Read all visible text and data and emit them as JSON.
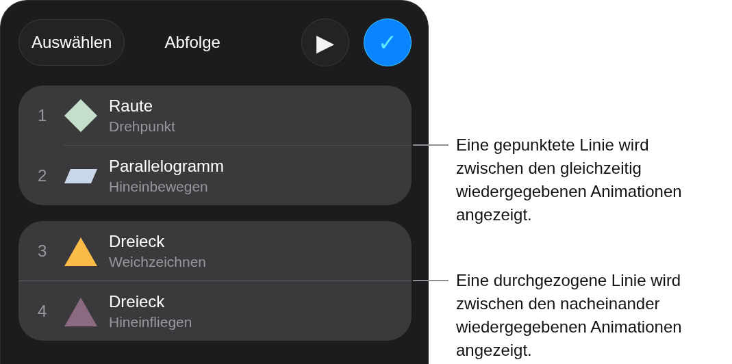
{
  "toolbar": {
    "select_button": "Auswählen",
    "title": "Abfolge",
    "play_button": "▶",
    "done_button": "✓"
  },
  "groups": [
    {
      "dotted": true,
      "items": [
        {
          "number": "1",
          "kind": "diamond",
          "color": "#c5dfcc",
          "title": "Raute",
          "effect": "Drehpunkt"
        },
        {
          "number": "2",
          "kind": "parallelogram",
          "color": "#c9d8e8",
          "title": "Parallelogramm",
          "effect": "Hineinbewegen"
        }
      ]
    },
    {
      "dotted": false,
      "items": [
        {
          "number": "3",
          "kind": "triangle",
          "color": "#fbbc47",
          "title": "Dreieck",
          "effect": "Weichzeichnen"
        },
        {
          "number": "4",
          "kind": "triangle",
          "color": "#8c6a82",
          "title": "Dreieck",
          "effect": "Hineinfliegen"
        }
      ]
    }
  ],
  "callouts": [
    {
      "text": "Eine gepunktete Linie wird zwischen den gleichzeitig wiedergegebenen Animationen angezeigt."
    },
    {
      "text": "Eine durchgezogene Linie wird zwischen den nacheinander wiedergegebenen Animationen angezeigt."
    }
  ]
}
